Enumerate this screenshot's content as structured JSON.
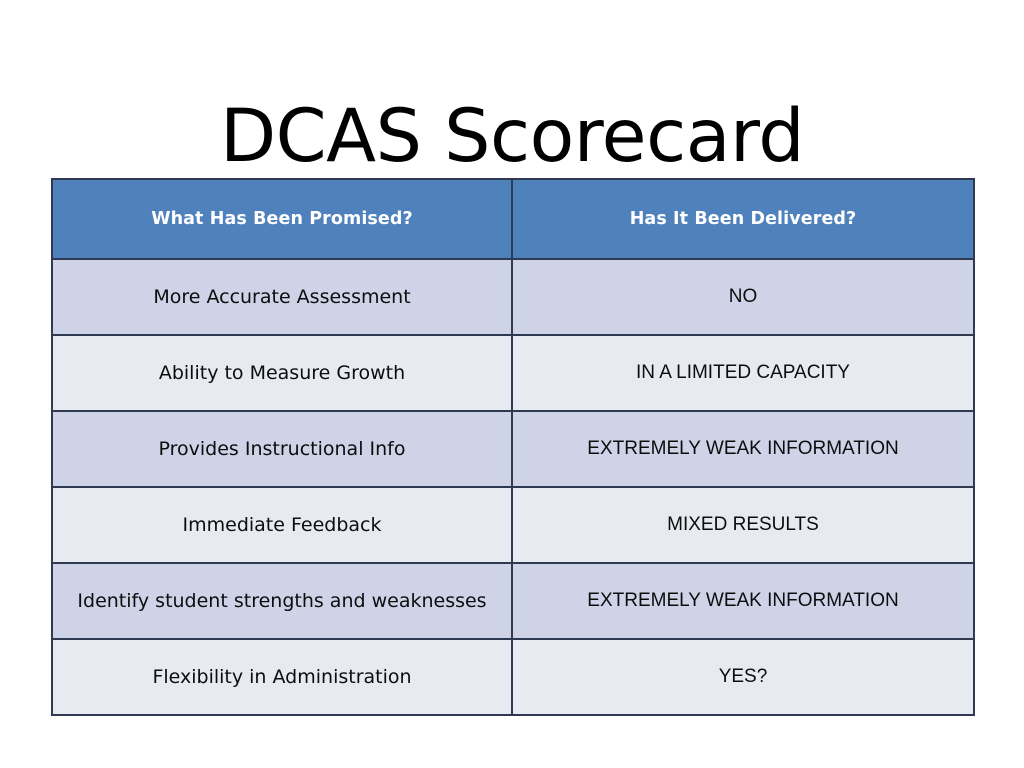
{
  "slide": {
    "title": "DCAS Scorecard",
    "background_color": "#ffffff"
  },
  "theme": {
    "header_background": "#4f81bd",
    "header_text_color": "#ffffff",
    "row_band_dark": "#ced3e8",
    "row_band_light": "#e8eaf2",
    "border_color": "#2f3a52",
    "body_text_color": "#0d0d0d"
  },
  "table": {
    "headers": [
      "What Has Been Promised?",
      "Has It Been Delivered?"
    ],
    "rows": [
      {
        "promised": "More Accurate Assessment",
        "delivered": "NO"
      },
      {
        "promised": "Ability to Measure Growth",
        "delivered": "IN A LIMITED CAPACITY"
      },
      {
        "promised": "Provides Instructional Info",
        "delivered": "EXTREMELY WEAK INFORMATION"
      },
      {
        "promised": "Immediate Feedback",
        "delivered": "MIXED RESULTS"
      },
      {
        "promised": "Identify student strengths and weaknesses",
        "delivered": "EXTREMELY WEAK INFORMATION"
      },
      {
        "promised": "Flexibility in Administration",
        "delivered": "YES?"
      }
    ]
  }
}
